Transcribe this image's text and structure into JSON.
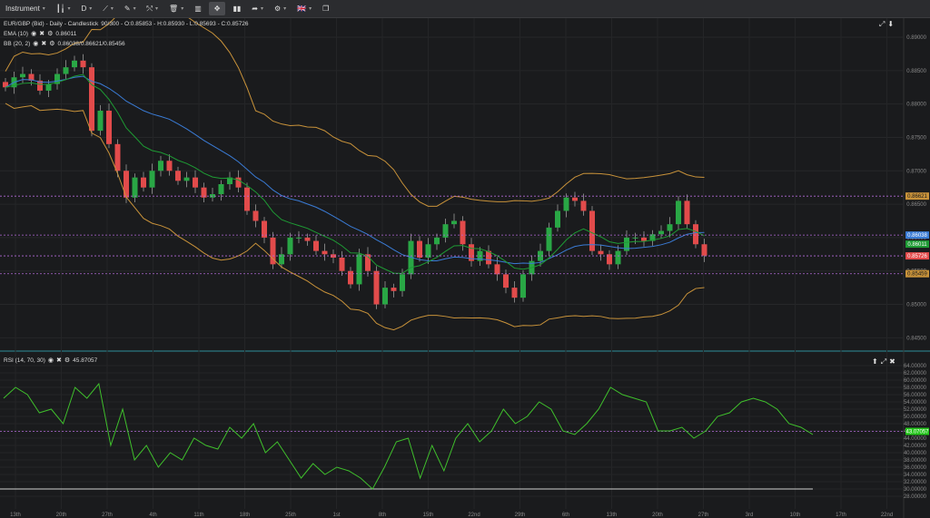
{
  "toolbar": {
    "instrument_label": "Instrument",
    "timeframe_label": "D",
    "flag": "🇬🇧"
  },
  "price_pane": {
    "title": "EUR/GBP (Bid) - Daily - Candlestick",
    "ohlc": "90/300 - O:0.85853 - H:0.85930 - L:0.85693 - C:0.85726",
    "ema_label": "EMA (10)",
    "ema_value": "0.86011",
    "bb_label": "BB (20, 2)",
    "bb_value": "0.86038/0.86621/0.85456",
    "price_axis": [
      "0.89000",
      "0.88500",
      "0.88000",
      "0.87500",
      "0.87000",
      "0.86500",
      "0.86000",
      "0.85500",
      "0.85000",
      "0.84500"
    ],
    "tags": {
      "bb_upper": "0.86621",
      "bb_mid": "0.86038",
      "ema": "0.86011",
      "last": "0.85726",
      "bb_lower": "0.85459"
    }
  },
  "rsi_pane": {
    "label": "RSI (14, 70, 30)",
    "value": "45.87057",
    "axis": [
      "64.00000",
      "62.00000",
      "60.00000",
      "58.00000",
      "56.00000",
      "54.00000",
      "52.00000",
      "50.00000",
      "48.00000",
      "46.00000",
      "44.00000",
      "42.00000",
      "40.00000",
      "38.00000",
      "36.00000",
      "34.00000",
      "32.00000",
      "30.00000",
      "28.00000"
    ],
    "tag": "43.07057"
  },
  "x_axis": [
    "13th",
    "20th",
    "27th",
    "4th",
    "11th",
    "18th",
    "25th",
    "1st",
    "8th",
    "15th",
    "22nd",
    "29th",
    "6th",
    "13th",
    "20th",
    "27th",
    "3rd",
    "10th",
    "17th",
    "22nd"
  ],
  "colors": {
    "up": "#29a745",
    "down": "#e24b4b",
    "ema": "#1e9b34",
    "bb": "#c8923a",
    "bbmid": "#3a7bd5",
    "rsi": "#3fbf2c"
  },
  "chart_data": {
    "type": "candlestick",
    "candles_close": [
      0.8825,
      0.884,
      0.8845,
      0.8835,
      0.882,
      0.883,
      0.8845,
      0.8855,
      0.8865,
      0.8855,
      0.876,
      0.879,
      0.874,
      0.87,
      0.866,
      0.869,
      0.8675,
      0.87,
      0.8715,
      0.87,
      0.8685,
      0.869,
      0.8675,
      0.866,
      0.8665,
      0.868,
      0.869,
      0.8675,
      0.864,
      0.8625,
      0.86,
      0.856,
      0.8575,
      0.86,
      0.86,
      0.8595,
      0.858,
      0.8575,
      0.857,
      0.855,
      0.853,
      0.8575,
      0.855,
      0.85,
      0.8525,
      0.852,
      0.8545,
      0.8595,
      0.857,
      0.859,
      0.86,
      0.862,
      0.8625,
      0.859,
      0.8565,
      0.858,
      0.856,
      0.8545,
      0.8525,
      0.851,
      0.8545,
      0.8565,
      0.858,
      0.8615,
      0.864,
      0.866,
      0.8655,
      0.864,
      0.858,
      0.8575,
      0.856,
      0.858,
      0.86,
      0.86,
      0.8595,
      0.8605,
      0.861,
      0.862,
      0.8655,
      0.862,
      0.859,
      0.8573
    ],
    "rsi_values": [
      55,
      58,
      56,
      51,
      52,
      48,
      58,
      55,
      59,
      42,
      52,
      38,
      42,
      36,
      40,
      38,
      44,
      42,
      41,
      47,
      44,
      48,
      40,
      43,
      38,
      33,
      37,
      34,
      36,
      35,
      33,
      30,
      36,
      43,
      44,
      33,
      42,
      35,
      44,
      48,
      43,
      46,
      52,
      48,
      50,
      54,
      52,
      46,
      45,
      48,
      52,
      58,
      56,
      55,
      54,
      46,
      46,
      47,
      44,
      46,
      50,
      51,
      54,
      55,
      54,
      52,
      48,
      47,
      45
    ]
  }
}
